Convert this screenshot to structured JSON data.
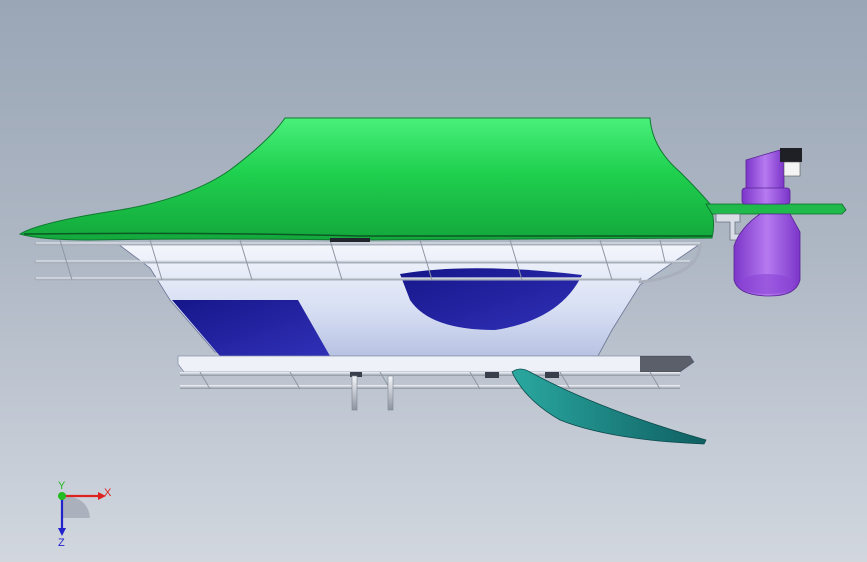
{
  "scene": {
    "colors": {
      "background_top": "#9aa6b6",
      "background_bottom": "#d2d7de",
      "canopy_green": "#22dd55",
      "hull_light": "#dfe6f7",
      "hull_blue": "#1c1c9a",
      "rails": "#c9ced6",
      "fin_teal": "#1f8a86",
      "nozzle_purple": "#9a55e0"
    }
  },
  "triad": {
    "x_label": "X",
    "y_label": "Y",
    "z_label": "Z",
    "x_color": "#dd2222",
    "y_color": "#22bb22",
    "z_color": "#2222cc"
  }
}
